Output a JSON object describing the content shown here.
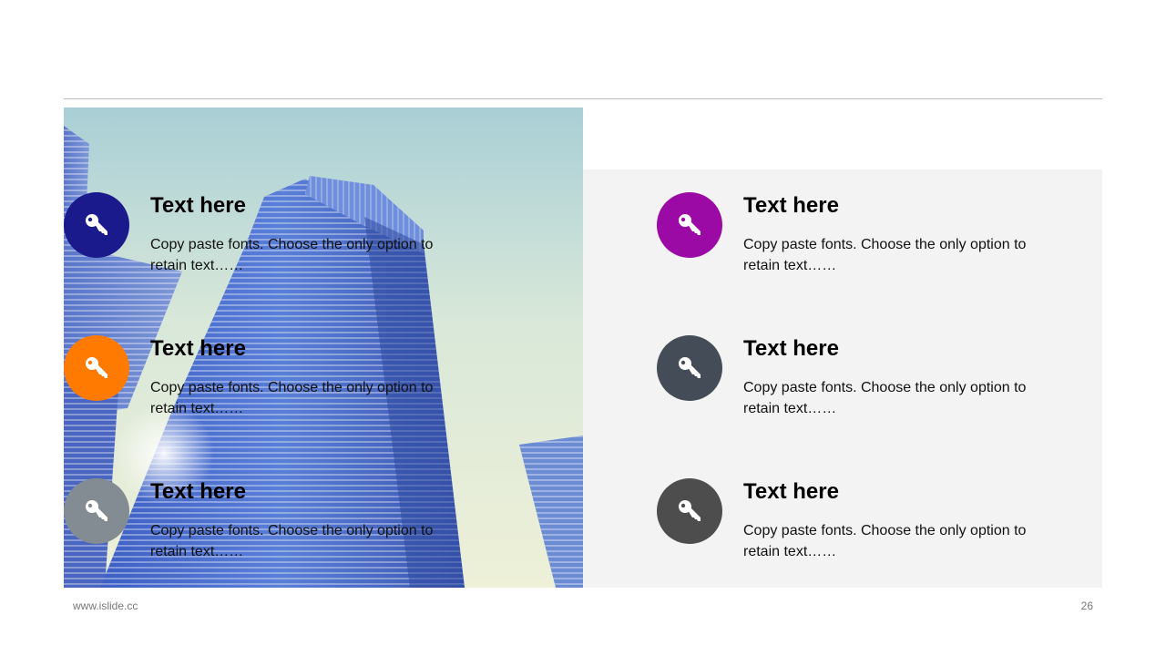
{
  "items": [
    {
      "title": "Text here",
      "body": "Copy paste fonts. Choose the only option to retain text……",
      "color": "#1a1a8c",
      "icon": "key-icon"
    },
    {
      "title": "Text here",
      "body": "Copy paste fonts. Choose the only option to retain text……",
      "color": "#ff7a00",
      "icon": "key-icon"
    },
    {
      "title": "Text here",
      "body": "Copy paste fonts. Choose the only option to retain text……",
      "color": "#838b93",
      "icon": "key-icon"
    },
    {
      "title": "Text here",
      "body": "Copy paste fonts. Choose the only option to retain text……",
      "color": "#9c0aa6",
      "icon": "key-icon"
    },
    {
      "title": "Text here",
      "body": "Copy paste fonts. Choose the only option to retain text……",
      "color": "#444c57",
      "icon": "key-icon"
    },
    {
      "title": "Text here",
      "body": "Copy paste fonts. Choose the only option to retain text……",
      "color": "#4d4d4d",
      "icon": "key-icon"
    }
  ],
  "footer": {
    "url": "www.islide.cc",
    "page_number": "26"
  }
}
